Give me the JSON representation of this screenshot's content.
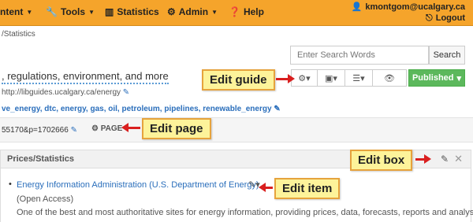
{
  "nav": {
    "items": [
      {
        "label": "ntent",
        "caret": true,
        "icon": ""
      },
      {
        "label": "Tools",
        "caret": true,
        "icon": "wrench-icon"
      },
      {
        "label": "Statistics",
        "caret": false,
        "icon": "bar-chart-icon"
      },
      {
        "label": "Admin",
        "caret": true,
        "icon": "gear-icon"
      },
      {
        "label": "Help",
        "caret": false,
        "icon": "help-icon"
      }
    ],
    "user_email": "kmontgom@ucalgary.ca",
    "logout_label": "Logout"
  },
  "breadcrumb": "/Statistics",
  "search": {
    "placeholder": "Enter Search Words",
    "button_label": "Search"
  },
  "guide": {
    "description": ", regulations, environment, and more",
    "url": "http://libguides.ucalgary.ca/energy",
    "tags": "ve_energy, dtc, energy, gas, oil, petroleum, pipelines, renewable_energy"
  },
  "toolbar": {
    "publish_label": "Published"
  },
  "page_row": {
    "id_text": "55170&p=1702666",
    "gear_label": "PAGE"
  },
  "box": {
    "title": "Prices/Statistics",
    "item_link": "Energy Information Administration (U.S. Department of Energy)",
    "item_access": "(Open Access)",
    "item_description": "One of the best and most authoritative sites for energy information, providing prices, data, forecasts, reports and analyses on"
  },
  "callouts": {
    "edit_guide": "Edit guide",
    "edit_page": "Edit page",
    "edit_box": "Edit box",
    "edit_item": "Edit item"
  },
  "colors": {
    "nav_bg": "#f5a42b",
    "publish_green": "#5cb85c",
    "callout_bg": "#fdf39a",
    "arrow_red": "#d91f1f",
    "link_blue": "#2a6ebb"
  }
}
